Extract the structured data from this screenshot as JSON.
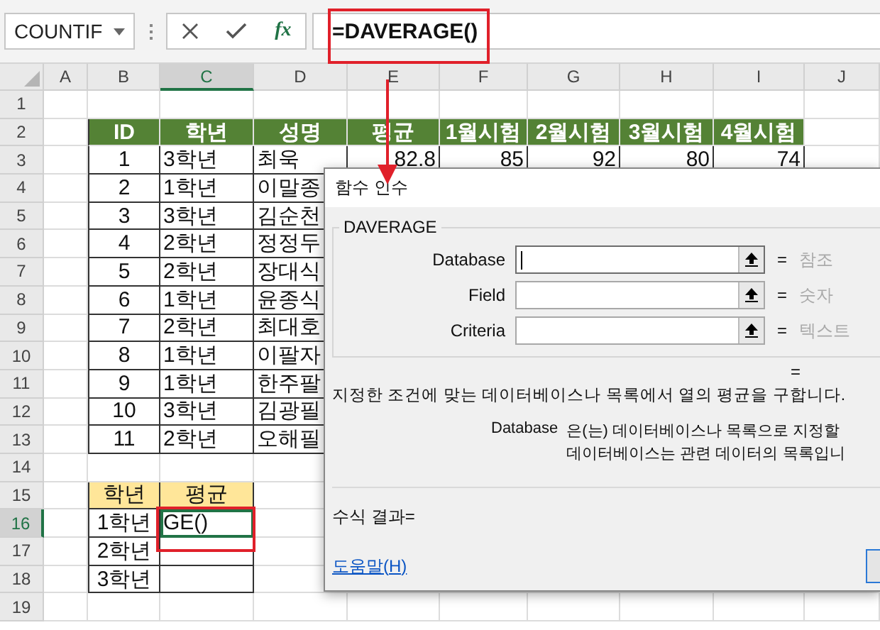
{
  "formula_bar": {
    "name_box": "COUNTIF",
    "function_label": "fx",
    "formula": "=DAVERAGE()"
  },
  "sheet": {
    "columns": [
      {
        "label": "A",
        "selected": false
      },
      {
        "label": "B",
        "selected": false
      },
      {
        "label": "C",
        "selected": true
      },
      {
        "label": "D",
        "selected": false
      },
      {
        "label": "E",
        "selected": false
      },
      {
        "label": "F",
        "selected": false
      },
      {
        "label": "G",
        "selected": false
      },
      {
        "label": "H",
        "selected": false
      },
      {
        "label": "I",
        "selected": false
      },
      {
        "label": "J",
        "selected": false
      }
    ],
    "rows": [
      {
        "label": "1",
        "selected": false
      },
      {
        "label": "2",
        "selected": false,
        "cells": [
          {
            "kind": "header",
            "text": "ID"
          },
          {
            "kind": "header",
            "text": "학년"
          },
          {
            "kind": "header",
            "text": "성명"
          },
          {
            "kind": "header",
            "text": "평균"
          },
          {
            "kind": "header",
            "text": "1월시험"
          },
          {
            "kind": "header",
            "text": "2월시험"
          },
          {
            "kind": "header",
            "text": "3월시험"
          },
          {
            "kind": "header",
            "text": "4월시험"
          }
        ]
      },
      {
        "label": "3",
        "selected": false,
        "cells": [
          {
            "kind": "id",
            "text": "1"
          },
          {
            "kind": "text",
            "text": "3학년"
          },
          {
            "kind": "text",
            "text": "최욱"
          },
          {
            "kind": "score",
            "text": "82.8"
          },
          {
            "kind": "score",
            "text": "85"
          },
          {
            "kind": "score",
            "text": "92"
          },
          {
            "kind": "score",
            "text": "80"
          },
          {
            "kind": "score",
            "text": "74"
          }
        ]
      },
      {
        "label": "4",
        "selected": false,
        "cells": [
          {
            "kind": "id",
            "text": "2"
          },
          {
            "kind": "text",
            "text": "1학년"
          },
          {
            "kind": "text",
            "text": "이말종"
          }
        ]
      },
      {
        "label": "5",
        "selected": false,
        "cells": [
          {
            "kind": "id",
            "text": "3"
          },
          {
            "kind": "text",
            "text": "3학년"
          },
          {
            "kind": "text",
            "text": "김순천"
          }
        ]
      },
      {
        "label": "6",
        "selected": false,
        "cells": [
          {
            "kind": "id",
            "text": "4"
          },
          {
            "kind": "text",
            "text": "2학년"
          },
          {
            "kind": "text",
            "text": "정정두"
          }
        ]
      },
      {
        "label": "7",
        "selected": false,
        "cells": [
          {
            "kind": "id",
            "text": "5"
          },
          {
            "kind": "text",
            "text": "2학년"
          },
          {
            "kind": "text",
            "text": "장대식"
          }
        ]
      },
      {
        "label": "8",
        "selected": false,
        "cells": [
          {
            "kind": "id",
            "text": "6"
          },
          {
            "kind": "text",
            "text": "1학년"
          },
          {
            "kind": "text",
            "text": "윤종식"
          }
        ]
      },
      {
        "label": "9",
        "selected": false,
        "cells": [
          {
            "kind": "id",
            "text": "7"
          },
          {
            "kind": "text",
            "text": "2학년"
          },
          {
            "kind": "text",
            "text": "최대호"
          }
        ]
      },
      {
        "label": "10",
        "selected": false,
        "cells": [
          {
            "kind": "id",
            "text": "8"
          },
          {
            "kind": "text",
            "text": "1학년"
          },
          {
            "kind": "text",
            "text": "이팔자"
          }
        ]
      },
      {
        "label": "11",
        "selected": false,
        "cells": [
          {
            "kind": "id",
            "text": "9"
          },
          {
            "kind": "text",
            "text": "1학년"
          },
          {
            "kind": "text",
            "text": "한주팔"
          }
        ]
      },
      {
        "label": "12",
        "selected": false,
        "cells": [
          {
            "kind": "id",
            "text": "10"
          },
          {
            "kind": "text",
            "text": "3학년"
          },
          {
            "kind": "text",
            "text": "김광필"
          }
        ]
      },
      {
        "label": "13",
        "selected": false,
        "cells": [
          {
            "kind": "id",
            "text": "11"
          },
          {
            "kind": "text",
            "text": "2학년"
          },
          {
            "kind": "text",
            "text": "오해필"
          }
        ]
      },
      {
        "label": "14",
        "selected": false
      },
      {
        "label": "15",
        "selected": false,
        "cells": [
          {
            "kind": "label",
            "text": "학년"
          },
          {
            "kind": "label",
            "text": "평균"
          }
        ]
      },
      {
        "label": "16",
        "selected": true,
        "cells": [
          {
            "kind": "id",
            "text": "1학년"
          },
          {
            "kind": "active",
            "text": "GE()"
          }
        ]
      },
      {
        "label": "17",
        "selected": false,
        "cells": [
          {
            "kind": "id",
            "text": "2학년"
          },
          {
            "kind": "blank"
          }
        ]
      },
      {
        "label": "18",
        "selected": false,
        "cells": [
          {
            "kind": "id",
            "text": "3학년"
          },
          {
            "kind": "blank"
          }
        ]
      },
      {
        "label": "19",
        "selected": false
      }
    ]
  },
  "dialog": {
    "title": "함수 인수",
    "function_name": "DAVERAGE",
    "arguments": [
      {
        "name": "Database",
        "equals": "=",
        "hint": "참조",
        "focused": true
      },
      {
        "name": "Field",
        "equals": "=",
        "hint": "숫자",
        "focused": false
      },
      {
        "name": "Criteria",
        "equals": "=",
        "hint": "텍스트",
        "focused": false
      }
    ],
    "result": "=",
    "description": "지정한 조건에 맞는 데이터베이스나 목록에서 열의 평균을 구합니다.",
    "help_argument": "Database",
    "help_lines": [
      "은(는) 데이터베이스나 목록으로 지정할",
      "데이터베이스는 관련 데이터의 목록입니"
    ],
    "formula_result": "수식 결과=",
    "help_link": "도움말(H)"
  }
}
